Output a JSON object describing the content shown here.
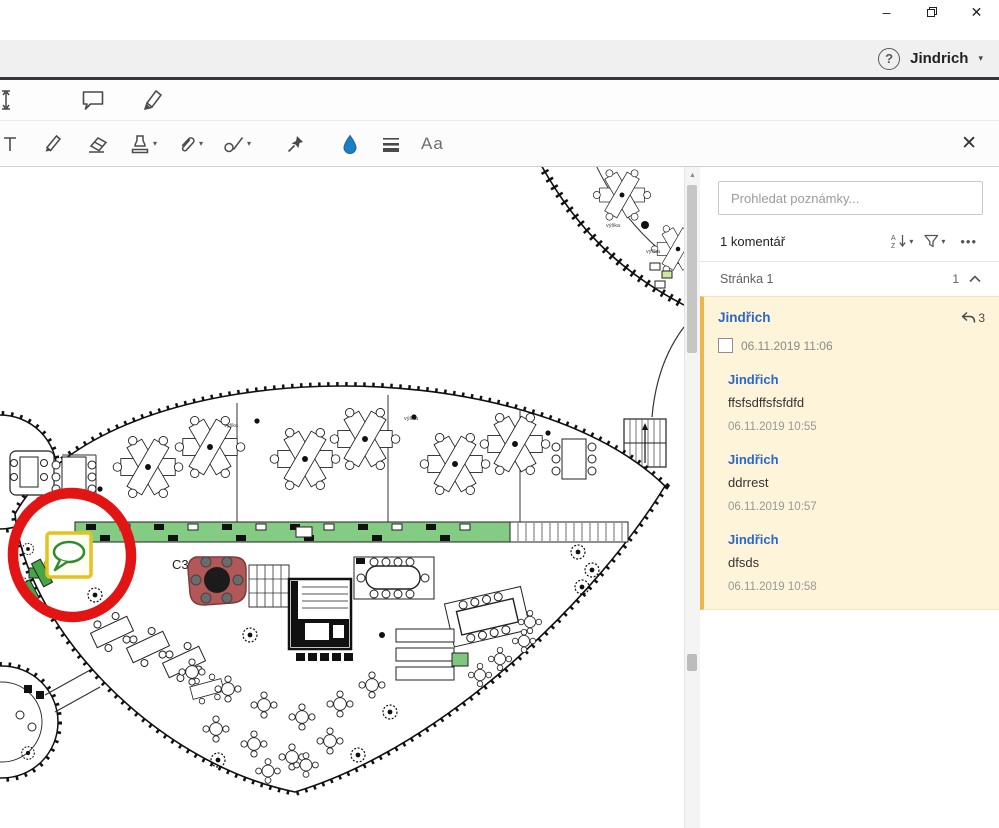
{
  "window": {
    "minimize": "–",
    "close": "✕"
  },
  "appbar": {
    "help": "?",
    "user": "Jindrich",
    "caret": "▾"
  },
  "toolbar": {
    "text_style": "Aa",
    "close": "✕",
    "caret": "▾"
  },
  "document": {
    "scroll_up": "▲"
  },
  "panel": {
    "search_placeholder": "Prohledat poznámky...",
    "comment_count": "1 komentář",
    "menu_dots": "•••",
    "caret": "▾",
    "page_label": "Stránka 1",
    "page_count": "1",
    "thread": {
      "author": "Jindřich",
      "reply_count": "3",
      "date": "06.11.2019 11:06",
      "replies": [
        {
          "author": "Jindřich",
          "text": "ffsfsdffsfsfdfd",
          "date": "06.11.2019 10:55"
        },
        {
          "author": "Jindřich",
          "text": "ddrrest",
          "date": "06.11.2019 10:57"
        },
        {
          "author": "Jindřich",
          "text": "dfsds",
          "date": "06.11.2019 10:58"
        }
      ]
    }
  },
  "plan": {
    "room_label": "C3",
    "height_label": "výška"
  },
  "colors": {
    "accent_blue": "#2a68c5",
    "thread_bg": "#fdf4da",
    "thread_accent": "#eeb54e",
    "annotation_red": "#e21414",
    "corridor_green": "#84cb84",
    "zone_red": "#b25858",
    "comment_icon_yellow": "#e3c41f",
    "bubble_green": "#2e8b2e",
    "fill_tool_blue": "#1b7fc4",
    "topbar_dark": "#34373c"
  }
}
